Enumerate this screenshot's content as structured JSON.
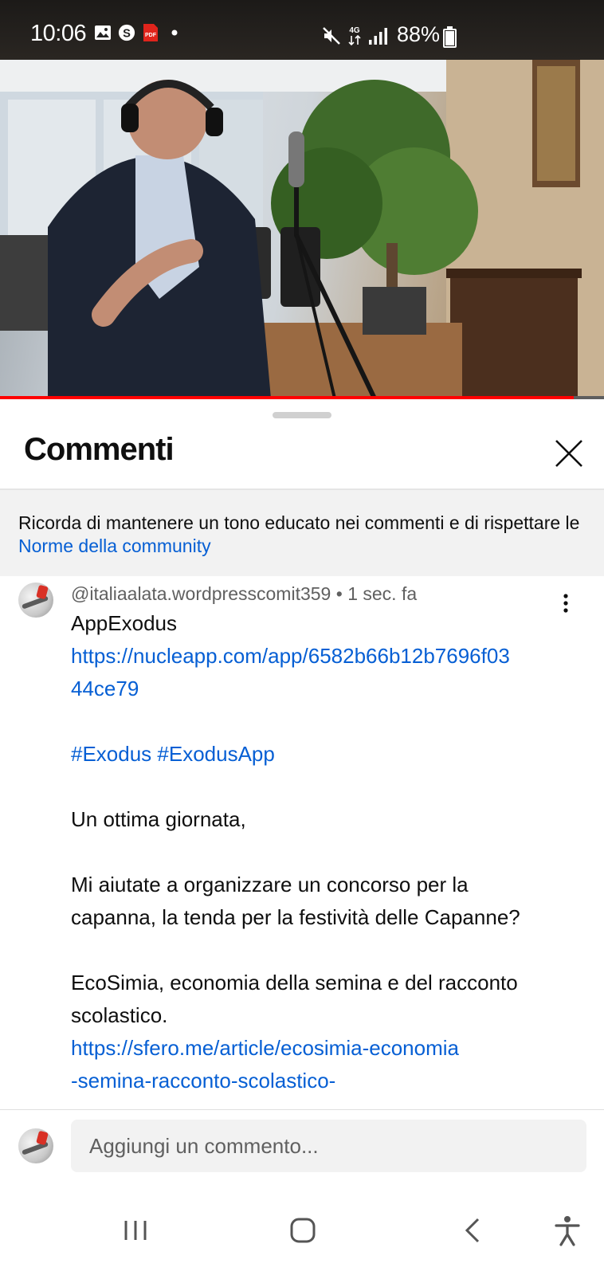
{
  "status_bar": {
    "time": "10:06",
    "battery": "88%",
    "battery_level": 0.88,
    "left_icons": [
      "gallery-icon",
      "skype-icon",
      "pdf-icon",
      "dot-icon"
    ],
    "right_icons": [
      "mute-icon",
      "4g-icon",
      "signal-icon"
    ]
  },
  "video": {
    "progress": 0.95,
    "progress_color": "#ff0000"
  },
  "comments_sheet": {
    "title": "Commenti",
    "notice_text": "Ricorda di mantenere un tono educato nei commenti e di rispettare le ",
    "notice_link": "Norme della community"
  },
  "comment": {
    "author": "@italiaalata.wordpresscomit359",
    "separator": "•",
    "time": "1 sec. fa",
    "lines": {
      "l1": "AppExodus",
      "l2": "https://nucleapp.com/app/6582b66b12b7696f03",
      "l3": "44ce79",
      "l4": "#Exodus #ExodusApp",
      "l5": "Un ottima giornata,",
      "l6": "Mi aiutate a organizzare un concorso per la",
      "l7": "capanna, la tenda per la festività delle Capanne?",
      "l8": "EcoSimia, economia della semina e del racconto",
      "l9": "scolastico.",
      "l10": "https://sfero.me/article/ecosimia-economia",
      "l11": "-semina-racconto-scolastico-"
    }
  },
  "composer": {
    "placeholder": "Aggiungi un commento..."
  },
  "nav_bar": {
    "buttons": [
      "recents-icon",
      "home-icon",
      "back-icon",
      "accessibility-icon"
    ]
  },
  "colors": {
    "link": "#065fd4",
    "notice_bg": "#f2f2f2",
    "meta_text": "#606060"
  }
}
